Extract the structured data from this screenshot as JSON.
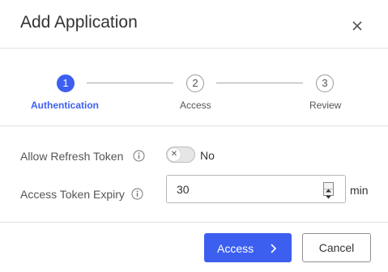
{
  "dialog": {
    "title": "Add Application"
  },
  "stepper": {
    "steps": [
      {
        "number": "1",
        "label": "Authentication",
        "state": "active"
      },
      {
        "number": "2",
        "label": "Access",
        "state": "pending"
      },
      {
        "number": "3",
        "label": "Review",
        "state": "pending"
      }
    ]
  },
  "form": {
    "refresh_token": {
      "label": "Allow Refresh Token",
      "toggle_state": "off",
      "toggle_text": "No"
    },
    "token_expiry": {
      "label": "Access Token Expiry",
      "value": "30",
      "unit": "min"
    }
  },
  "footer": {
    "primary_label": "Access",
    "secondary_label": "Cancel"
  },
  "colors": {
    "accent": "#3d5ff0",
    "text": "#333333",
    "muted": "#555555",
    "divider": "#e0e0e0"
  },
  "icons": {
    "close": "close-icon",
    "info": "info-icon",
    "toggle_off": "x-icon",
    "next": "chevron-right-icon"
  }
}
